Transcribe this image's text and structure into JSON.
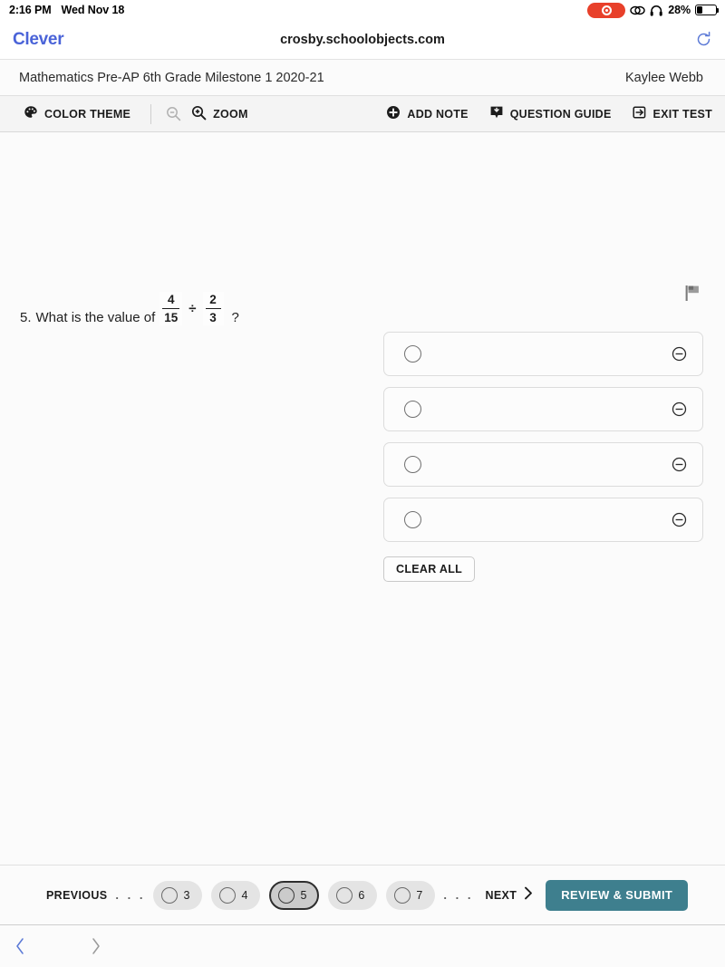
{
  "statusbar": {
    "time": "2:16 PM",
    "date": "Wed Nov 18",
    "battery_percent": "28%",
    "recording_icon": "record-indicator",
    "screen_mirror_icon": "screen-mirroring-icon",
    "headphones_icon": "headphones-icon",
    "battery_icon": "battery-icon"
  },
  "browser": {
    "tab_label": "Clever",
    "url": "crosby.schoolobjects.com",
    "reload_icon": "reload-icon",
    "back_icon": "chevron-left-icon",
    "forward_icon": "chevron-right-icon"
  },
  "test_header": {
    "title": "Mathematics Pre-AP 6th Grade Milestone 1 2020-21",
    "student": "Kaylee Webb"
  },
  "toolbar": {
    "color_theme": "COLOR THEME",
    "color_theme_icon": "palette-icon",
    "zoom_out_icon": "zoom-out-icon",
    "zoom_in_icon": "zoom-in-icon",
    "zoom": "ZOOM",
    "add_note": "ADD NOTE",
    "add_note_icon": "plus-circle-icon",
    "question_guide": "QUESTION GUIDE",
    "question_guide_icon": "question-guide-icon",
    "exit_test": "EXIT TEST",
    "exit_test_icon": "exit-icon"
  },
  "question": {
    "number": "5.",
    "prompt": "What is the value of",
    "fraction_1": {
      "numerator": "4",
      "denominator": "15"
    },
    "operator": "÷",
    "fraction_2": {
      "numerator": "2",
      "denominator": "3"
    },
    "suffix": "?",
    "flag_icon": "flag-icon"
  },
  "choices": [
    {
      "label": "",
      "selected": false,
      "eliminate_icon": "minus-circle-icon"
    },
    {
      "label": "",
      "selected": false,
      "eliminate_icon": "minus-circle-icon"
    },
    {
      "label": "",
      "selected": false,
      "eliminate_icon": "minus-circle-icon"
    },
    {
      "label": "",
      "selected": false,
      "eliminate_icon": "minus-circle-icon"
    }
  ],
  "clear_all": "CLEAR ALL",
  "bottom_nav": {
    "previous": "PREVIOUS",
    "ellipsis_left": ". . .",
    "ellipsis_right": ". . .",
    "questions": [
      {
        "number": "3",
        "active": false
      },
      {
        "number": "4",
        "active": false
      },
      {
        "number": "5",
        "active": true
      },
      {
        "number": "6",
        "active": false
      },
      {
        "number": "7",
        "active": false
      }
    ],
    "next": "NEXT",
    "next_icon": "chevron-right-icon",
    "submit": "REVIEW & SUBMIT"
  },
  "colors": {
    "accent_teal": "#3e7f8e",
    "clever_blue": "#4a63d8",
    "record_red": "#e8402a"
  }
}
